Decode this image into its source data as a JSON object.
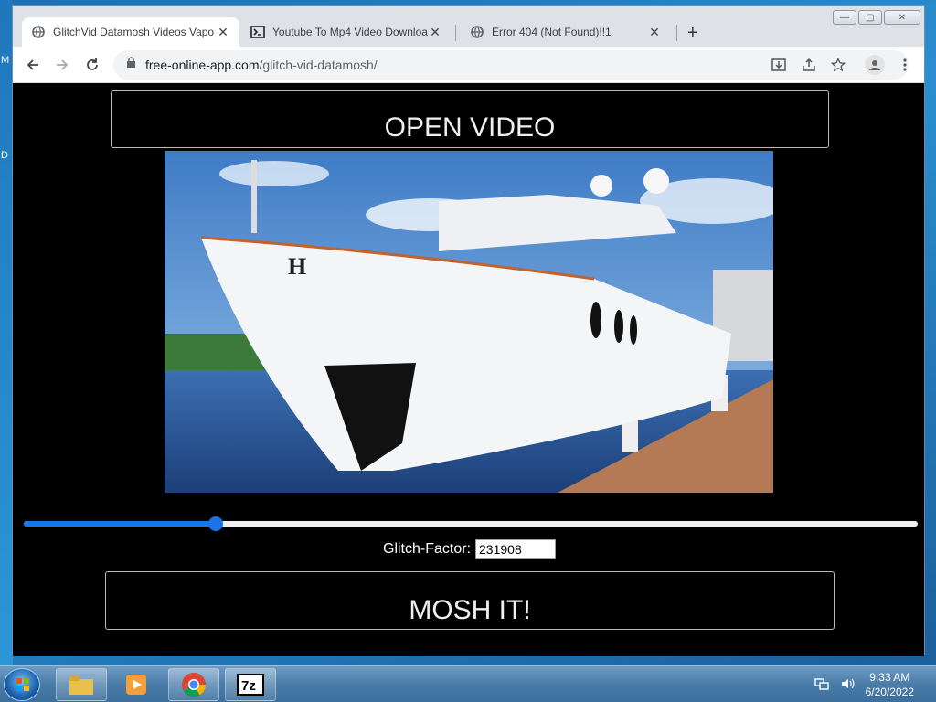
{
  "browser": {
    "tabs": [
      {
        "title": "GlitchVid Datamosh Videos Vapo",
        "active": true,
        "icon": "globe-icon"
      },
      {
        "title": "Youtube To Mp4 Video Downloa",
        "active": false,
        "icon": "download-site-icon"
      },
      {
        "title": "Error 404 (Not Found)!!1",
        "active": false,
        "icon": "globe-icon"
      }
    ],
    "url_host": "free-online-app.com",
    "url_path": "/glitch-vid-datamosh/"
  },
  "page": {
    "open_video_label": "OPEN VIDEO",
    "mosh_label": "MOSH IT!",
    "glitch_label": "Glitch-Factor:",
    "glitch_value": "231908",
    "slider_fraction": 0.215,
    "preview_image": "white-yacht-at-dock"
  },
  "taskbar": {
    "time": "9:33 AM",
    "date": "6/20/2022",
    "apps": [
      "file-explorer-icon",
      "media-player-icon",
      "chrome-icon",
      "7zip-icon"
    ]
  },
  "desktop": {
    "letters": [
      "M",
      "D"
    ]
  },
  "colors": {
    "accent": "#1a73e8",
    "page_bg": "#000000"
  }
}
